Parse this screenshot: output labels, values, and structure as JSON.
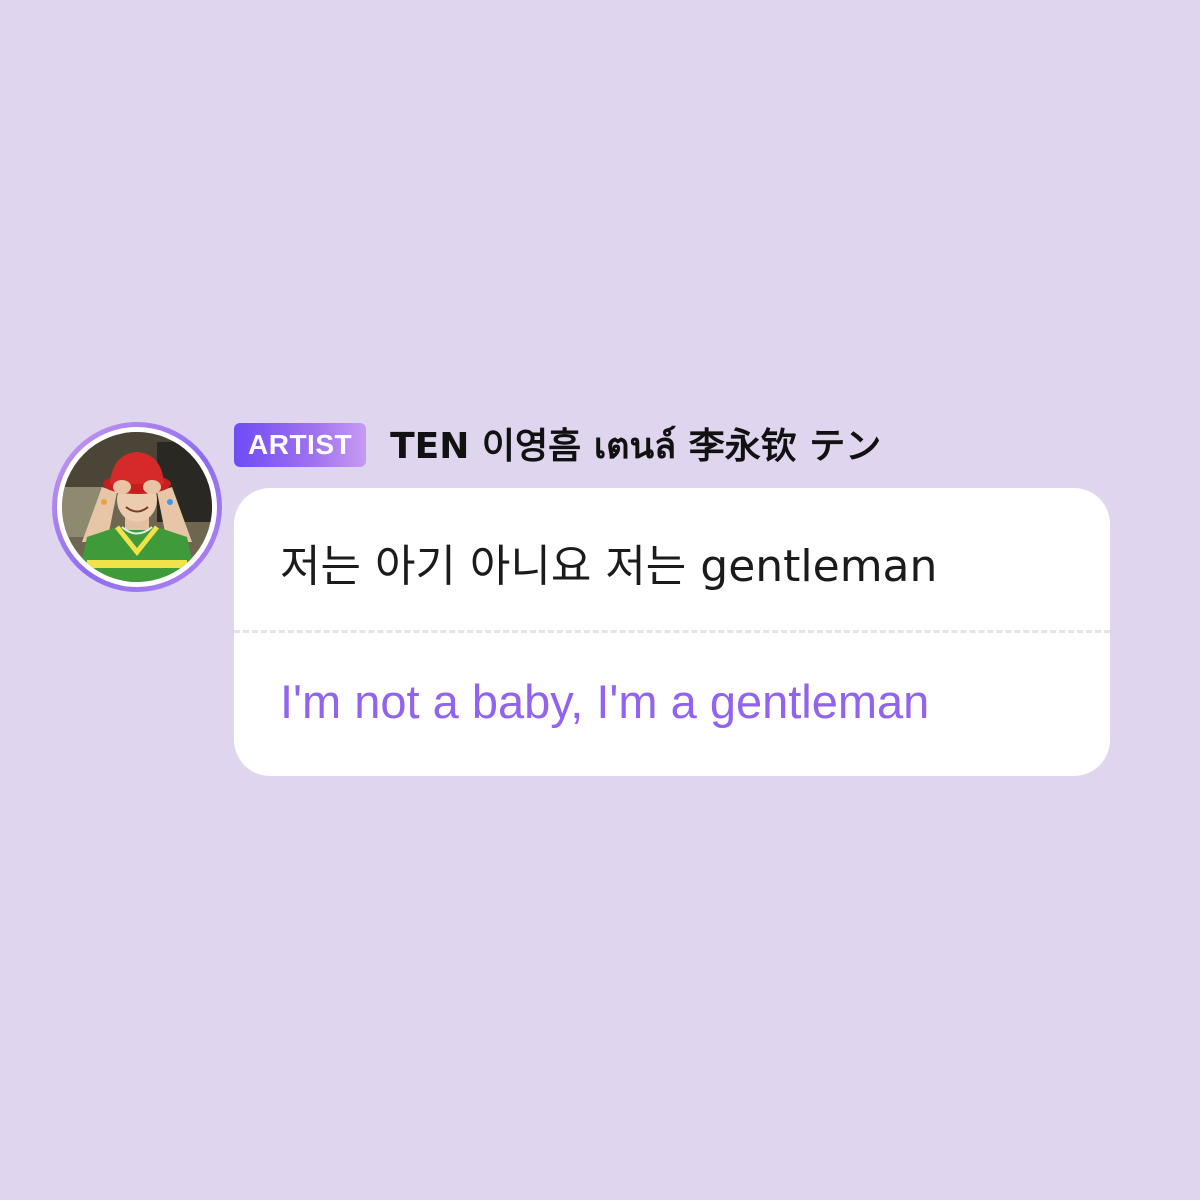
{
  "background_color": "#dfd5ee",
  "accent_color": "#9163ee",
  "message": {
    "badge_label": "ARTIST",
    "author_name": "TEN 이영흠 เตนล์ 李永钦 テン",
    "avatar_icon": "user-avatar-photo",
    "original_text": "저는 아기 아니요 저는 gentleman",
    "translated_text": "I'm not a baby, I'm a gentleman"
  }
}
